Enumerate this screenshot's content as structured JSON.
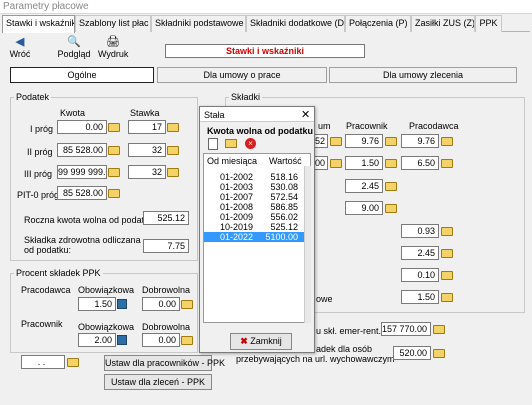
{
  "window": {
    "title": "Parametry płacowe"
  },
  "tabs": [
    "Stawki i wskaźniki",
    "Szablony list płac",
    "Składniki podstawowe (A)",
    "Składniki dodatkowe (D)",
    "Połączenia (P)",
    "Zasiłki ZUS (Z)",
    "PPK"
  ],
  "toolbar": {
    "back": "Wróć",
    "preview": "Podgląd",
    "print": "Wydruk"
  },
  "section_title": "Stawki i wskaźniki",
  "subtabs": [
    "Ogólne",
    "Dla umowy o prace",
    "Dla umowy zlecenia"
  ],
  "podatek": {
    "title": "Podatek",
    "col_kwota": "Kwota",
    "col_stawka": "Stawka",
    "prog1_label": "I próg",
    "prog1_kwota": "0.00",
    "prog1_stawka": "17",
    "prog2_label": "II próg",
    "prog2_kwota": "85 528.00",
    "prog2_stawka": "32",
    "prog3_label": "III próg",
    "prog3_kwota": "99 999 999.00",
    "prog3_stawka": "32",
    "pit0_label": "PIT-0 próg",
    "pit0_kwota": "85 528.00",
    "roczna_label": "Roczna kwota wolna od podatku:",
    "roczna_value": "525.12",
    "zdrow_label1": "Składka zdrowotna odliczana",
    "zdrow_label2": "od podatku:",
    "zdrow_value": "7.75"
  },
  "ppk": {
    "title": "Procent składek PPK",
    "pracodawca": "Pracodawca",
    "pracownik": "Pracownik",
    "obowiazkowa": "Obowiązkowa",
    "dobrowolna": "Dobrowolna",
    "pracodawca_obow": "1.50",
    "pracodawca_dobr": "0.00",
    "pracownik_obow": "2.00",
    "pracownik_dobr": "0.00",
    "date_value": ". .",
    "btn_pracownikow": "Ustaw dla pracowników - PPK",
    "btn_zlecen": "Ustaw dla zleceń - PPK"
  },
  "skladki": {
    "title": "Składki",
    "col_pracownik": "Pracownik",
    "col_pracodawca": "Pracodawca",
    "col_um": "um",
    "r1_pfx": "52",
    "r1_prac": "9.76",
    "r1_pracod": "9.76",
    "r2_pfx": "00",
    "r2_prac": "1.50",
    "r2_pracod": "6.50",
    "r3_prac": "2.45",
    "r4_prac": "9.00",
    "v_093": "0.93",
    "v_245": "2.45",
    "v_010": "0.10",
    "v_150": "1.50",
    "lbl_owe": "owe",
    "lbl_emer": "u skł. emer-rent.",
    "val_emer": "157 770.00",
    "lbl_osob1": "adek dla osób",
    "lbl_osob2": "przebywających na url. wychowawczym",
    "val_osob": "520.00"
  },
  "dialog": {
    "title": "Stała",
    "heading": "Kwota wolna od podatku",
    "col_od": "Od miesiąca",
    "col_wart": "Wartość",
    "rows": [
      {
        "m": "01-2002",
        "v": "518.16"
      },
      {
        "m": "01-2003",
        "v": "530.08"
      },
      {
        "m": "01-2007",
        "v": "572.54"
      },
      {
        "m": "01-2008",
        "v": "586.85"
      },
      {
        "m": "01-2009",
        "v": "556.02"
      },
      {
        "m": "10-2019",
        "v": "525.12"
      },
      {
        "m": "01-2022",
        "v": "5100.00"
      }
    ],
    "close": "Zamknij"
  }
}
